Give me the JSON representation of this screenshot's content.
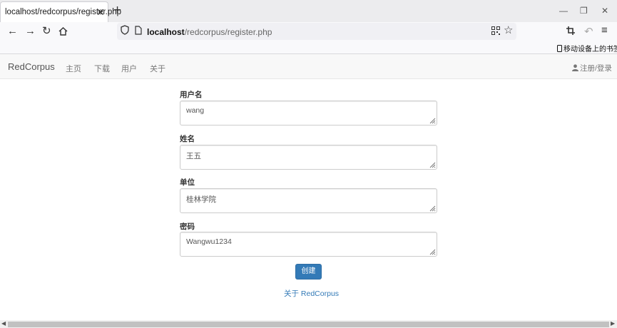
{
  "browser": {
    "tab_title": "localhost/redcorpus/register.php",
    "url_host": "localhost",
    "url_path": "/redcorpus/register.php",
    "bookmark_label": "移动设备上的书签",
    "icons": [
      "back-icon",
      "forward-icon",
      "reload-icon",
      "home-icon",
      "shield-icon",
      "page-icon",
      "qr-code-icon",
      "star-icon",
      "crop-icon",
      "undo-icon",
      "menu-icon"
    ]
  },
  "site": {
    "brand": "RedCorpus",
    "nav": [
      "主页",
      "下载",
      "用户",
      "关于"
    ],
    "login": "注册/登录"
  },
  "form": {
    "fields": [
      {
        "label": "用户名",
        "value": "wang"
      },
      {
        "label": "姓名",
        "value": "王五"
      },
      {
        "label": "单位",
        "value": "桂林学院"
      },
      {
        "label": "密码",
        "value": "Wangwu1234"
      }
    ],
    "submit_label": "创建",
    "about_link": "关于 RedCorpus"
  },
  "colors": {
    "primary": "#337ab7",
    "navbar_bg": "#f8f8f8"
  }
}
